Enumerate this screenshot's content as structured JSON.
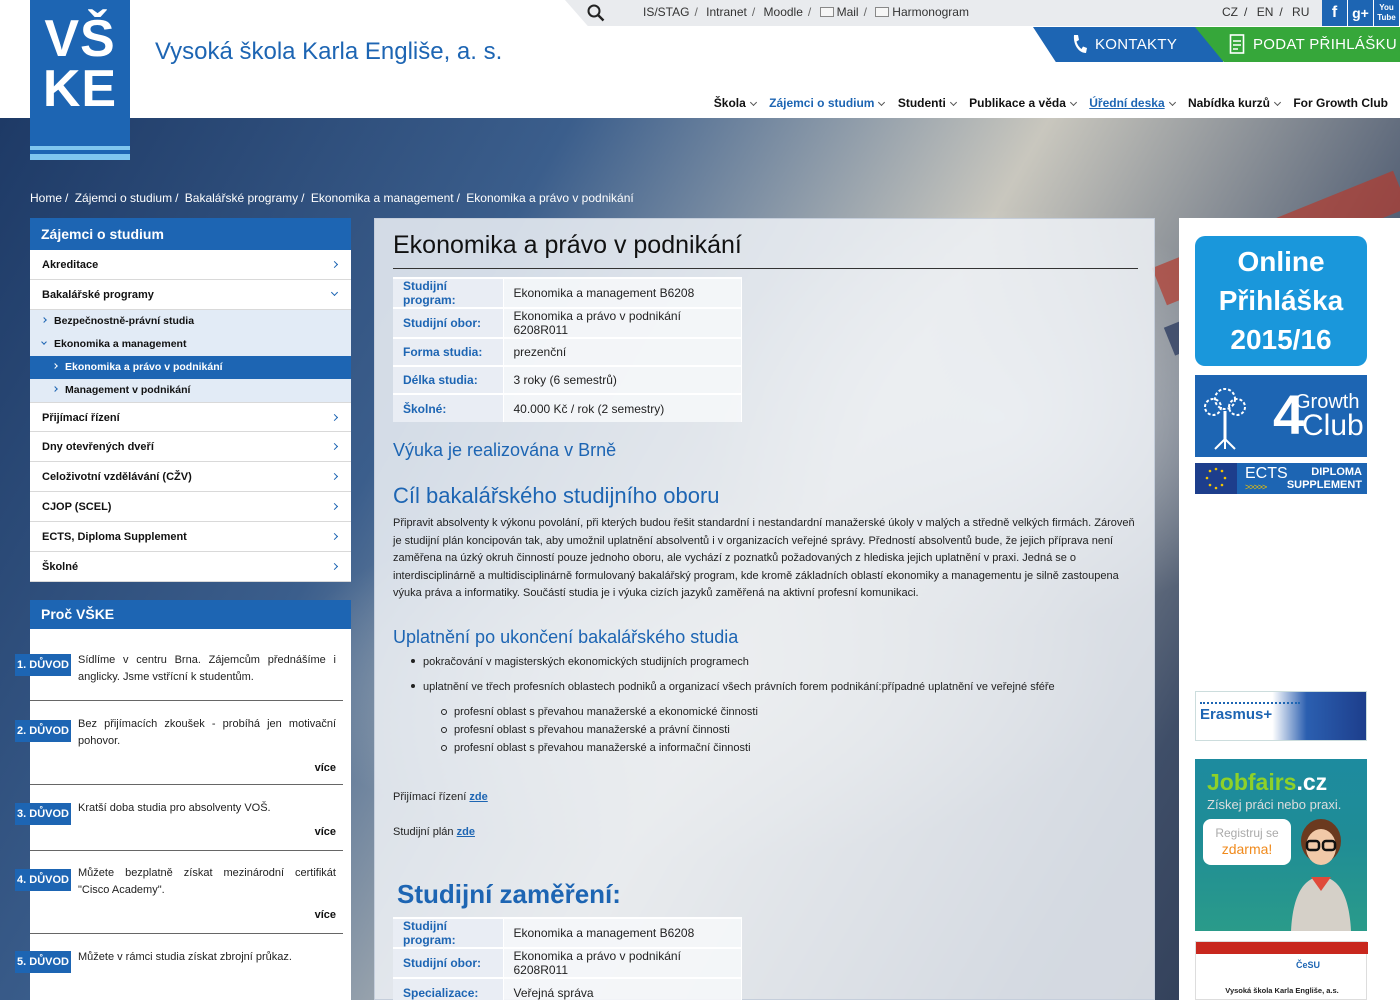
{
  "header": {
    "logo_text": "VŠ\nKE",
    "school_name": "Vysoká škola Karla Engliše, a. s.",
    "toplinks": [
      "IS/STAG",
      "Intranet",
      "Moodle",
      "Mail",
      "Harmonogram"
    ],
    "langs": [
      "CZ",
      "EN",
      "RU"
    ],
    "social": [
      "f",
      "g+",
      "You\nTube"
    ],
    "kontakty_label": "KONTAKTY",
    "prihlaska_label": "PODAT PŘIHLÁŠKU",
    "nav": [
      "Škola",
      "Zájemci o studium",
      "Studenti",
      "Publikace a věda",
      "Úřední deska",
      "Nabídka kurzů",
      "For Growth Club"
    ]
  },
  "breadcrumb": [
    "Home",
    "Zájemci o studium",
    "Bakalářské programy",
    "Ekonomika a management",
    "Ekonomika a právo v podnikání"
  ],
  "sidebar": {
    "head": "Zájemci o studium",
    "items_top": [
      "Akreditace",
      "Bakalářské programy"
    ],
    "sub": [
      "Bezpečnostně-právní studia",
      "Ekonomika a management",
      "Ekonomika a právo v podnikání",
      "Management v podnikání"
    ],
    "items_bottom": [
      "Přijímací řízení",
      "Dny otevřených dveří",
      "Celoživotní vzdělávání (CŽV)",
      "CJOP (SCEL)",
      "ECTS, Diploma Supplement",
      "Školné"
    ]
  },
  "why": {
    "head": "Proč VŠKE",
    "reasons": [
      {
        "badge": "1. DŮVOD",
        "text": "Sídlíme v centru Brna. Zájemcům přednášíme i anglicky. Jsme vstřícní k studentům.",
        "more": ""
      },
      {
        "badge": "2. DŮVOD",
        "text": "Bez přijímacích zkoušek - probíhá jen motivační pohovor.",
        "more": "více"
      },
      {
        "badge": "3. DŮVOD",
        "text": "Kratší doba studia pro absolventy VOŠ.",
        "more": "více"
      },
      {
        "badge": "4. DŮVOD",
        "text": "Můžete bezplatně získat mezinárodní certifikát \"Cisco Academy\".",
        "more": "více"
      },
      {
        "badge": "5. DŮVOD",
        "text": "Můžete v rámci studia získat zbrojní průkaz.",
        "more": ""
      }
    ]
  },
  "main": {
    "title": "Ekonomika a právo v podnikání",
    "info": [
      {
        "k": "Studijní program:",
        "v": "Ekonomika a management B6208"
      },
      {
        "k": "Studijní obor:",
        "v": "Ekonomika a právo v podnikání 6208R011"
      },
      {
        "k": "Forma studia:",
        "v": "prezenční"
      },
      {
        "k": "Délka studia:",
        "v": "3 roky (6 semestrů)"
      },
      {
        "k": "Školné:",
        "v": "40.000 Kč / rok (2 semestry)"
      }
    ],
    "h_brno": "Výuka je realizována v Brně",
    "h_goal": "Cíl bakalářského studijního oboru",
    "goal_text": "Připravit absolventy k výkonu povolání, při kterých budou řešit standardní i nestandardní manažerské úkoly v malých a středně velkých firmách. Zároveň je studijní plán koncipován tak, aby umožnil uplatnění absolventů i v organizacích veřejné správy. Předností absolventů bude, že jejich příprava není zaměřena na úzký okruh činností pouze jednoho oboru, ale vychází z poznatků požadovaných z hlediska jejich uplatnění v praxi. Jedná se o interdisciplinárně a multidisciplinárně formulovaný bakalářský program, kde kromě základních oblastí ekonomiky a managementu je silně zastoupena výuka práva a informatiky. Součástí studia je i výuka cizích jazyků zaměřená na aktivní profesní komunikaci.",
    "h_career": "Uplatnění po ukončení bakalářského studia",
    "bullets": [
      "pokračování v magisterských ekonomických studijních programech",
      "uplatnění ve třech profesních oblastech podniků a organizací všech právních forem podnikání:případné uplatnění ve veřejné sféře"
    ],
    "subbullets": [
      "profesní oblast s převahou manažerské a ekonomické činnosti",
      "profesní oblast s převahou manažerské a právní činnosti",
      "profesní oblast s převahou manažerské a informační činnosti"
    ],
    "prijimaci_label": "Přijímací řízení",
    "plan_label": "Studijní plán",
    "link_zde": "zde",
    "h_focus": "Studijní zaměření:",
    "focus": [
      {
        "k": "Studijní program:",
        "v": "Ekonomika a management B6208"
      },
      {
        "k": "Studijní obor:",
        "v": "Ekonomika a právo v podnikání 6208R011"
      },
      {
        "k": "Specializace:",
        "v": "Veřejná správa"
      }
    ]
  },
  "right": {
    "online": [
      "Online",
      "Přihláška",
      "2015/16"
    ],
    "growth_num": "4",
    "growth_1": "Growth",
    "growth_2": "Club",
    "ects": "ECTS",
    "ects_arrows": ">>>>>",
    "diploma_1": "DIPLOMA",
    "diploma_2": "SUPPLEMENT",
    "erasmus": "Erasmus+",
    "jobfairs_1": "Jobfairs",
    "jobfairs_2": ".cz",
    "jobfairs_sub": "Získej práci nebo praxi.",
    "bubble_1": "Registruj se",
    "bubble_2": "zdarma!",
    "cesu_logo": "ČeSU",
    "cesu_text": "Vysoká škola Karla Engliše, a.s."
  },
  "colors": {
    "brand_blue": "#1d65b3",
    "green": "#36a73a",
    "light_blue": "#1a97db"
  }
}
